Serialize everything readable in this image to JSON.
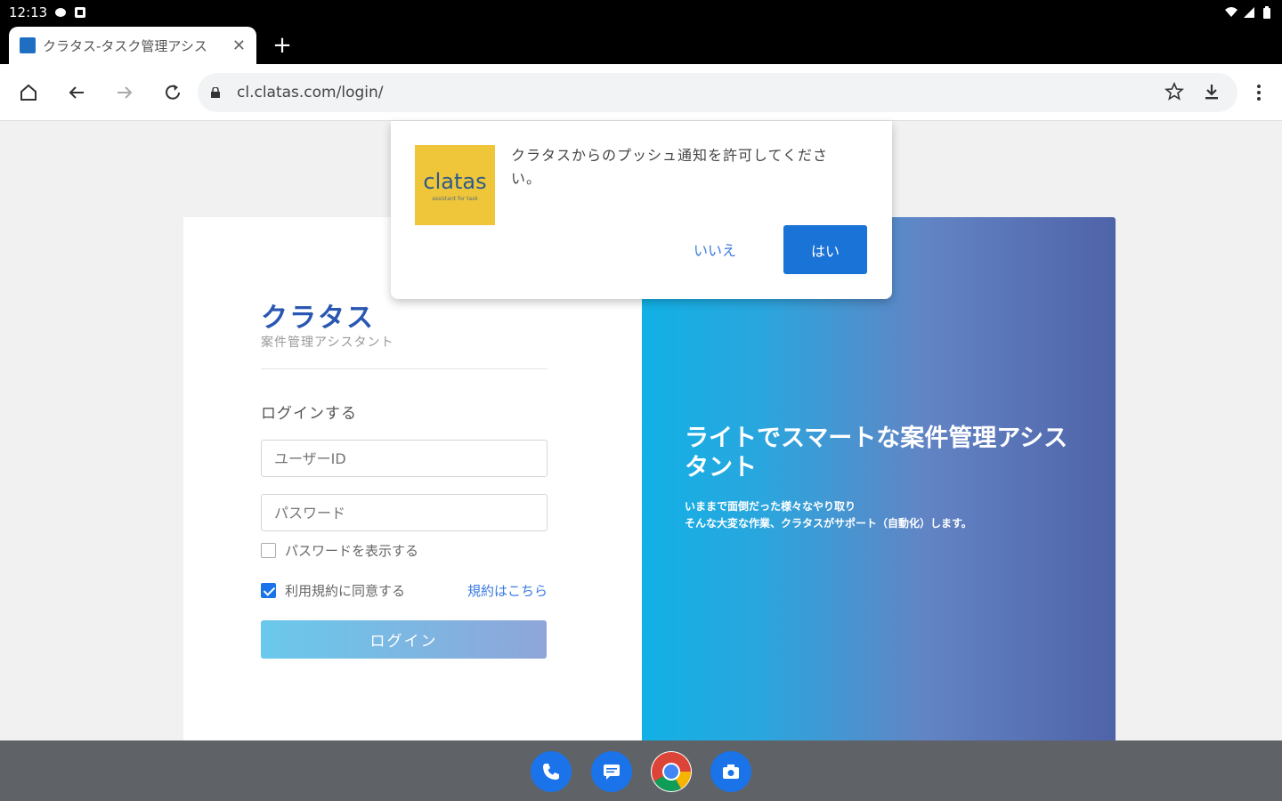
{
  "status_bar": {
    "time": "12:13"
  },
  "browser": {
    "tab_title": "クラタス-タスク管理アシス",
    "tab_close": "✕",
    "new_tab": "+",
    "url": "cl.clatas.com/login/"
  },
  "notification": {
    "logo_text": "clatas",
    "logo_subtext": "assistant for task",
    "message": "クラタスからのプッシュ通知を許可してください。",
    "no_label": "いいえ",
    "yes_label": "はい"
  },
  "login": {
    "brand_title": "クラタス",
    "brand_subtitle": "案件管理アシスタント",
    "heading": "ログインする",
    "user_placeholder": "ユーザーID",
    "password_placeholder": "パスワード",
    "show_password_label": "パスワードを表示する",
    "agree_label": "利用規約に同意する",
    "terms_link": "規約はこちら",
    "login_button": "ログイン"
  },
  "hero": {
    "title": "ライトでスマートな案件管理アシスタント",
    "line1": "いままで面倒だった様々なやり取り",
    "line2": "そんな大変な作業、クラタスがサポート（自動化）します。"
  },
  "colors": {
    "accent": "#1a73d6",
    "brand": "#2a57b2",
    "logo_bg": "#efc63a"
  }
}
